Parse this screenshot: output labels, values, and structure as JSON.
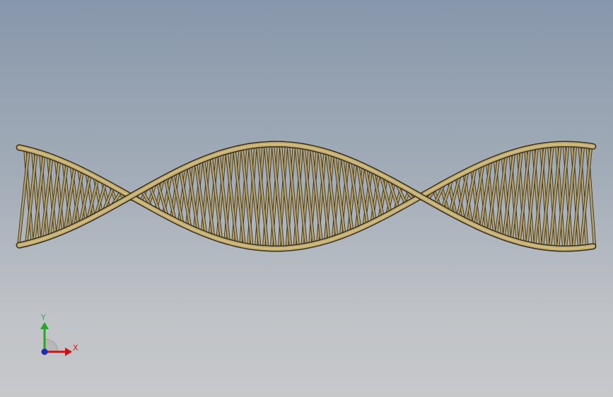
{
  "triad": {
    "y_label": "Y",
    "x_label": "X",
    "colors": {
      "x_axis": "#c81414",
      "y_axis": "#22a822",
      "z_axis": "#1a2fb8",
      "plane": "#b8b8b8"
    }
  },
  "model": {
    "colors": {
      "strut_fill": "#b3a06a",
      "strut_edge": "#3e3520",
      "rail_fill": "#c2ad72",
      "rail_edge": "#3b321c",
      "background_top": "#8797ab",
      "background_bottom": "#c6c8ca"
    }
  }
}
